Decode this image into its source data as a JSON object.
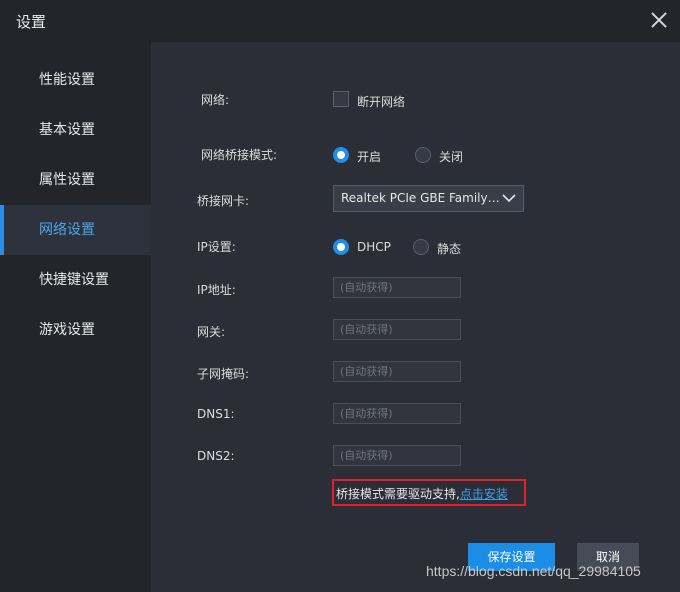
{
  "window": {
    "title": "设置"
  },
  "sidebar": {
    "items": [
      {
        "label": "性能设置"
      },
      {
        "label": "基本设置"
      },
      {
        "label": "属性设置"
      },
      {
        "label": "网络设置",
        "active": true
      },
      {
        "label": "快捷键设置"
      },
      {
        "label": "游戏设置"
      }
    ]
  },
  "network": {
    "network_label": "网络:",
    "disconnect_label": "断开网络",
    "disconnect_checked": false,
    "bridge_mode_label": "网络桥接模式:",
    "bridge_on_label": "开启",
    "bridge_off_label": "关闭",
    "bridge_mode_value": "开启",
    "bridge_nic_label": "桥接网卡:",
    "bridge_nic_value": "Realtek PCIe GBE Family ...",
    "ip_settings_label": "IP设置:",
    "ip_dhcp_label": "DHCP",
    "ip_static_label": "静态",
    "ip_mode_value": "DHCP",
    "ip_address_label": "IP地址:",
    "gateway_label": "网关:",
    "subnet_label": "子网掩码:",
    "dns1_label": "DNS1:",
    "dns2_label": "DNS2:",
    "auto_placeholder": "(自动获得)",
    "notice_text": "桥接模式需要驱动支持,",
    "notice_link": "点击安装"
  },
  "footer": {
    "save_label": "保存设置",
    "cancel_label": "取消",
    "watermark": "https://blog.csdn.net/qq_29984105"
  },
  "colors": {
    "accent": "#1c8de6",
    "background": "#23252b",
    "panel": "#2b2e36",
    "notice_border": "#e2202a"
  }
}
